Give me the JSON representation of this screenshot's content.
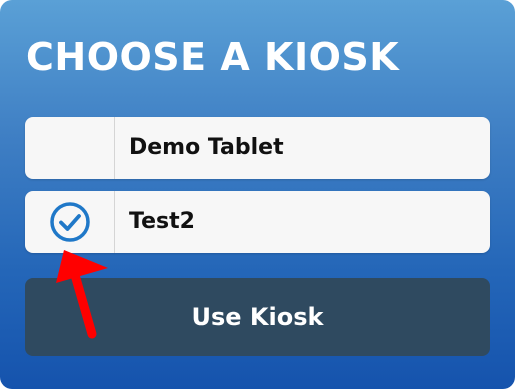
{
  "dialog": {
    "title": "CHOOSE A KIOSK"
  },
  "kiosks": [
    {
      "label": "Demo Tablet",
      "selected": false
    },
    {
      "label": "Test2",
      "selected": true
    }
  ],
  "actions": {
    "use_label": "Use Kiosk"
  },
  "colors": {
    "panel_top": "#5aa0d6",
    "panel_bottom": "#1553ad",
    "button_bg": "#2f4a60",
    "check_color": "#1f78c8",
    "annotation_arrow": "#ff0000"
  },
  "icons": {
    "selected": "check-circle-icon",
    "annotation": "red-arrow-annotation"
  }
}
